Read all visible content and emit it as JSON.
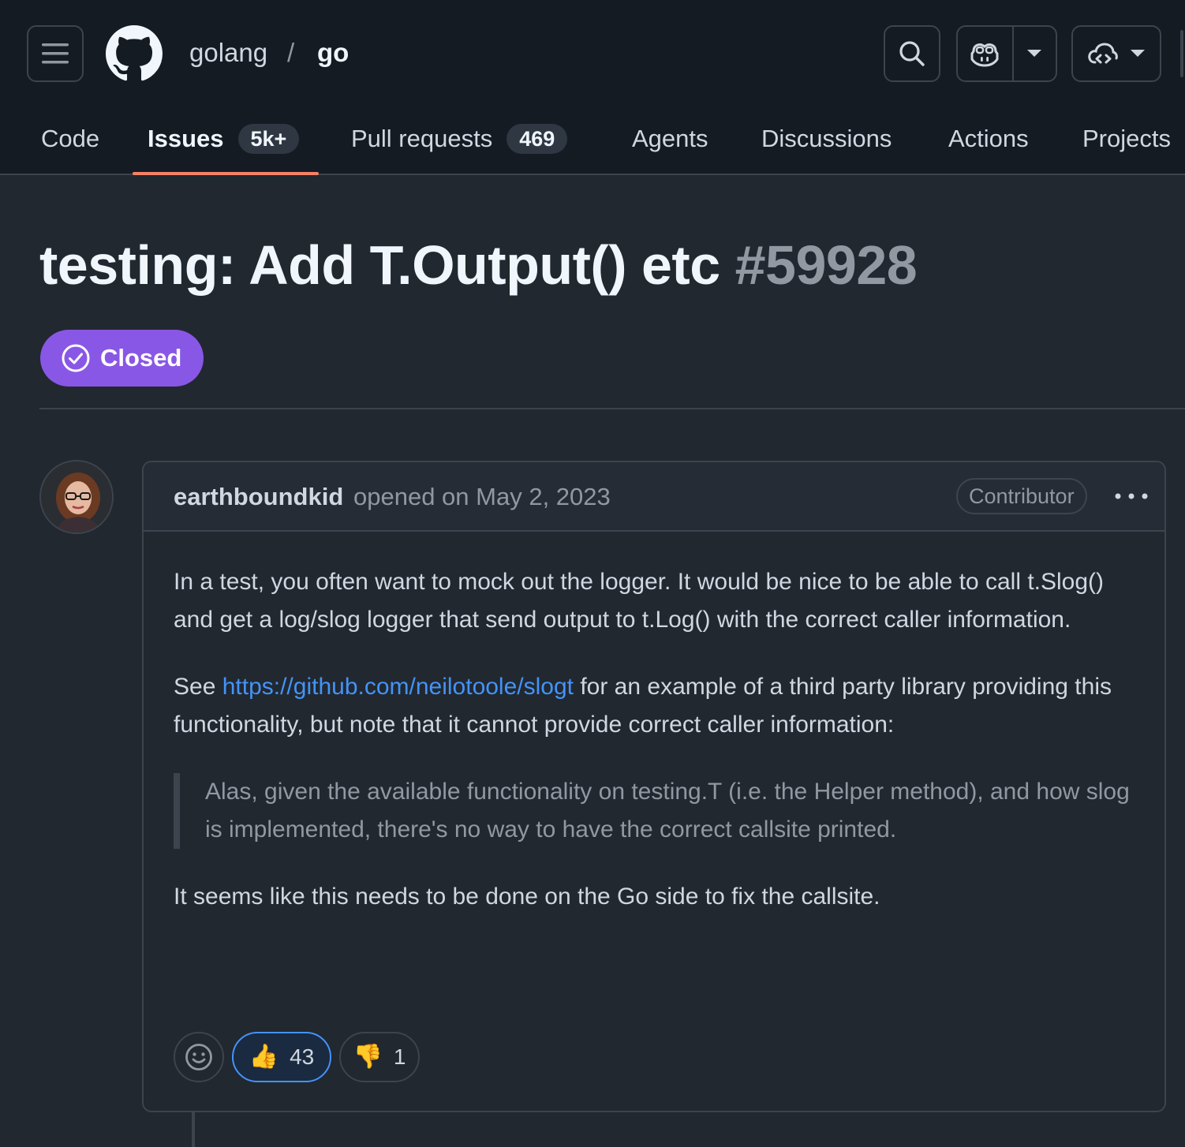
{
  "header": {
    "owner": "golang",
    "separator": "/",
    "repo": "go"
  },
  "tabs": [
    {
      "label": "Code"
    },
    {
      "label": "Issues",
      "count": "5k+"
    },
    {
      "label": "Pull requests",
      "count": "469"
    },
    {
      "label": "Agents"
    },
    {
      "label": "Discussions"
    },
    {
      "label": "Actions"
    },
    {
      "label": "Projects"
    }
  ],
  "issue": {
    "title": "testing: Add T.Output() etc",
    "number": "#59928",
    "state": "Closed",
    "state_color": "#8957e5"
  },
  "comment": {
    "author": "earthboundkid",
    "meta": "opened on May 2, 2023",
    "role": "Contributor",
    "p1": "In a test, you often want to mock out the logger. It would be nice to be able to call t.Slog() and get a log/slog logger that send output to t.Log() with the correct caller information.",
    "p2_prefix": "See ",
    "p2_link": "https://github.com/neilotoole/slogt",
    "p2_suffix": " for an example of a third party library providing this functionality, but note that it cannot provide correct caller information:",
    "quote": "Alas, given the available functionality on testing.T (i.e. the Helper method), and how slog is implemented, there's no way to have the correct callsite printed.",
    "p3": "It seems like this needs to be done on the Go side to fix the callsite."
  },
  "reactions": [
    {
      "emoji": "👍",
      "count": "43",
      "selected": true
    },
    {
      "emoji": "👎",
      "count": "1",
      "selected": false
    }
  ],
  "colors": {
    "header_bg": "#151b23",
    "page_bg": "#212830",
    "accent_underline": "#f78166",
    "link": "#4493f8"
  }
}
